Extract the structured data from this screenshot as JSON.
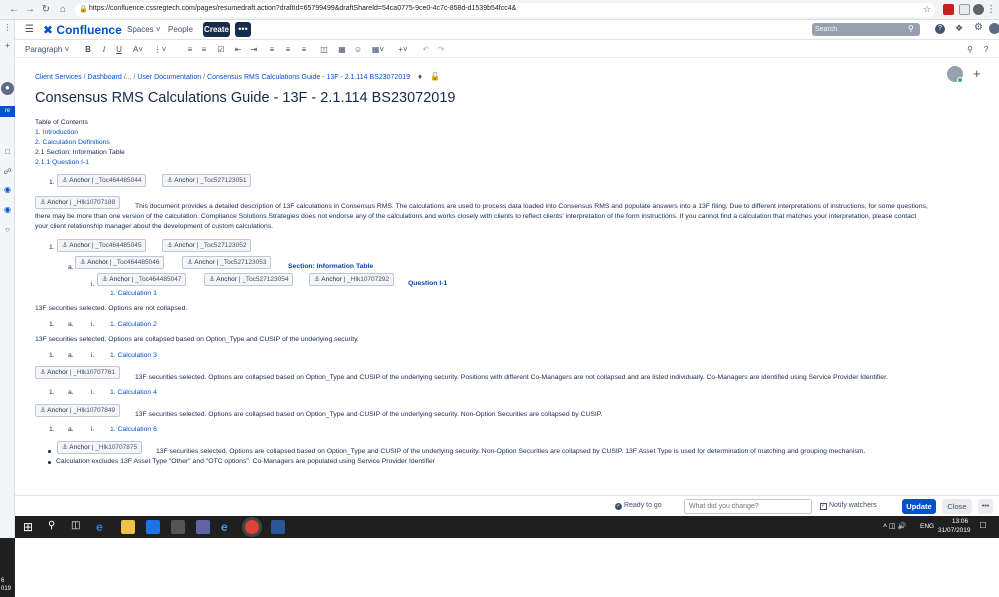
{
  "browser": {
    "url": "https://confluence.cssregtech.com/pages/resumedraft.action?draftId=65799499&draftShareId=54ca0775-9ce0-4c7c-858d-d1539b54fcc4&"
  },
  "header": {
    "logo": "Confluence",
    "spaces": "Spaces",
    "people": "People",
    "create": "Create",
    "more": "•••",
    "search_placeholder": "Search"
  },
  "toolbar": {
    "paragraph": "Paragraph"
  },
  "breadcrumb": [
    "Client Services",
    "Dashboard",
    "/...",
    "User Documentation",
    "Consensus RMS Calculations Guide - 13F - 2.1.114 BS23072019"
  ],
  "page": {
    "title": "Consensus RMS Calculations Guide - 13F - 2.1.114 BS23072019",
    "toc_title": "Table of Contents",
    "toc": [
      "1. Introduction",
      "2. Calculation Definitions",
      "2.1 Section: Information Table",
      "2.1.1 Question I-1"
    ],
    "anchor_label": "Anchor",
    "anchors": {
      "a1": "| _Toc464485044",
      "a2": "| _Toc527123051",
      "a3": "| _Hlk10707188",
      "a4": "| _Toc464485045",
      "a5": "| _Toc527123052",
      "a6": "| _Toc464485046",
      "a7": "| _Toc527123053",
      "a8": "| _Toc464485047",
      "a9": "| _Toc527123054",
      "a10": "| _Hlk10707292",
      "a11": "| _Hlk10707761",
      "a12": "| _Hlk10707849",
      "a13": "| _Hlk10707875"
    },
    "intro_line1": "This document provides a detailed description of 13F calculations in Consensus RMS. The calculations are used to process data loaded into Consensus RMS and populate answers into a 13F filing. Due to different interpretations of instructions, for some questions,",
    "intro_line2": "there may be more than one version of the calculation. Compliance Solutions Strategies does not endorse any of the calculations and works closely with clients to reflect clients' interpretation of the form instructions. If you cannot find a calculation that matches your interpretation, please contact",
    "intro_line3": "your client relationship manager about the development of custom calculations.",
    "section_heading": "Section: Information Table",
    "question_heading": "Question I-1",
    "calc1": "1. Calculation 1",
    "calc1_text": "13F securities selected. Options are not collapsed.",
    "calc2": "1. Calculation 2",
    "calc2_text": "13F securities selected. Options are collapsed based on Option_Type and CUSIP of the underlying security.",
    "calc3": "1. Calculation 3",
    "calc3_text": "13F securities selected. Options are collapsed based on Option_Type and CUSIP of the underlying security. Positions with different Co-Managers are not collapsed and are listed individually. Co-Managers are identified using Service Provider Identifier.",
    "calc4": "1. Calculation 4",
    "calc4_text": "13F securities selected. Options are collapsed based on Option_Type and CUSIP of the underlying security. Non-Option Securities are collapsed by CUSIP.",
    "calc6": "1. Calculation 6",
    "calc6_text": "13F securities selected. Options are collapsed based on Option_Type and CUSIP of the underlying security. Non-Option Securities are collapsed by CUSIP. 13F Asset Type is used for determination of matching and grouping mechanism.",
    "calc6_text2": "Calculation excludes 13F Asset Type \"Other\" and \"OTC options\". Co-Managers are populated using Service Provider Identifier",
    "num_1": "1.",
    "num_a": "a.",
    "num_i": "i."
  },
  "footer": {
    "status": "Ready to go",
    "change_placeholder": "What did you change?",
    "notify": "Notify watchers",
    "update": "Update",
    "close": "Close",
    "more": "•••"
  },
  "taskbar": {
    "lang": "ENG",
    "time": "13:06",
    "date": "31/07/2019"
  },
  "left_edge": {
    "glyph1": "re",
    "num": "6",
    "year": "019"
  },
  "colors": {
    "accent": "#0052cc",
    "link": "#0052cc"
  }
}
